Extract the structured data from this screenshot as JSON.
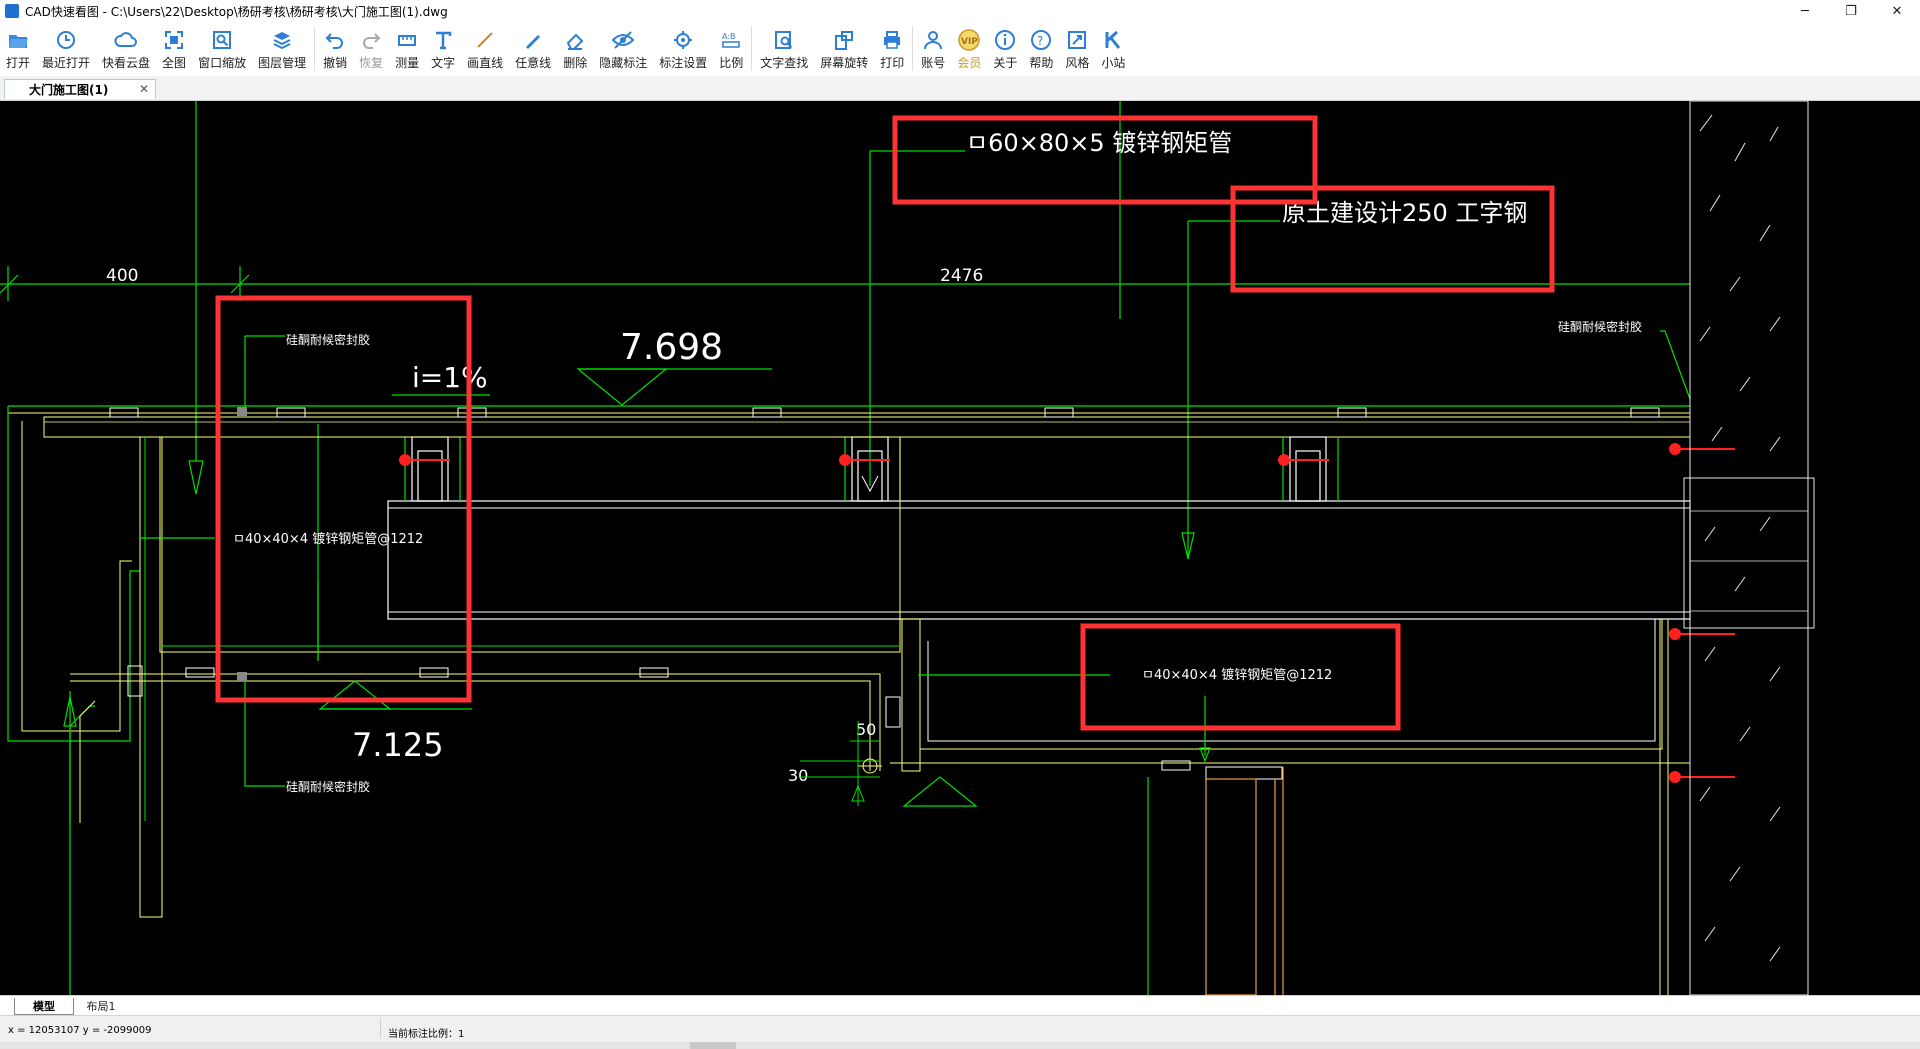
{
  "window": {
    "title": "CAD快速看图 - C:\\Users\\22\\Desktop\\杨研考核\\杨研考核\\大门施工图(1).dwg",
    "minimize": "─",
    "maximize": "❐",
    "close": "✕"
  },
  "toolbar": {
    "open": "打开",
    "recent": "最近打开",
    "cloud": "快看云盘",
    "fullview": "全图",
    "window_zoom": "窗口缩放",
    "layers": "图层管理",
    "undo": "撤销",
    "redo": "恢复",
    "measure": "测量",
    "text": "文字",
    "line": "画直线",
    "freeline": "任意线",
    "delete": "删除",
    "hide_annot": "隐藏标注",
    "annot_settings": "标注设置",
    "scale": "比例",
    "find_text": "文字查找",
    "rotate": "屏幕旋转",
    "print": "打印",
    "account": "账号",
    "vip": "会员",
    "about": "关于",
    "help": "帮助",
    "style": "风格",
    "site": "小站"
  },
  "icons": {
    "open": "folder-open-icon",
    "recent": "clock-icon",
    "cloud": "cloud-icon",
    "fullview": "fullview-icon",
    "window_zoom": "window-zoom-icon",
    "layers": "layers-icon",
    "undo": "undo-icon",
    "redo": "redo-icon",
    "measure": "ruler-icon",
    "text": "text-icon",
    "line": "line-icon",
    "freeline": "pen-icon",
    "delete": "eraser-icon",
    "hide_annot": "eye-icon",
    "annot_settings": "settings-icon",
    "scale": "scale-icon",
    "find_text": "find-text-icon",
    "rotate": "rotate-screen-icon",
    "print": "printer-icon",
    "account": "user-icon",
    "vip": "vip-icon",
    "about": "info-icon",
    "help": "help-icon",
    "style": "style-icon",
    "site": "k-logo-icon"
  },
  "tabs": {
    "document": "大门施工图(1)",
    "close": "✕"
  },
  "sheets": {
    "model": "模型",
    "layout": "布局1"
  },
  "status": {
    "coords": "x = 12053107  y = -2099009",
    "scale": "当前标注比例：1"
  },
  "drawing": {
    "dim_400": "400",
    "dim_2476": "2476",
    "dim_50": "50",
    "dim_30": "30",
    "elev_top": "7.698",
    "elev_bottom": "7.125",
    "slope": "i=1%",
    "label_tube_top": "ㅁ60×80×5 镀锌钢矩管",
    "label_steel": "原土建设计250 工字钢",
    "label_tube_left": "ㅁ40×40×4 镀锌钢矩管@1212",
    "label_tube_bottom": "ㅁ40×40×4 镀锌钢矩管@1212",
    "label_plate_1": "硅酮耐候密封胶",
    "label_plate_2": "硅酮耐候密封胶",
    "label_plate_3": "硅酮耐候密封胶"
  },
  "colors": {
    "canvas_bg": "#000000",
    "green": "#00e000",
    "yellow": "#ffff7a",
    "white": "#ffffff",
    "red_box": "#ff3333",
    "red_anchor": "#ff2020",
    "hatch": "#e8e8e8",
    "orange": "#e8a040"
  }
}
